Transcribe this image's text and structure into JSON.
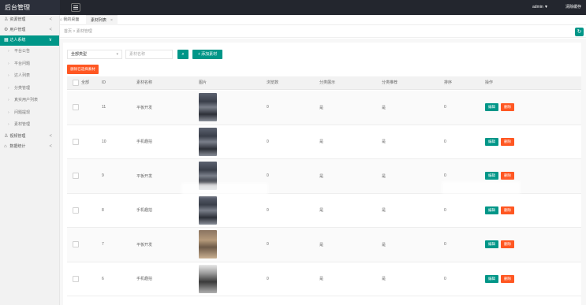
{
  "header": {
    "brand": "后台管理",
    "user": "admin ▼",
    "logout": "清除缓存"
  },
  "sidebar": {
    "items": [
      {
        "icon": "user-icon",
        "glyph": "♙",
        "label": "资源管理",
        "arrow": "<"
      },
      {
        "icon": "gear-icon",
        "glyph": "⚙",
        "label": "用户管理",
        "arrow": "<"
      },
      {
        "icon": "grid-icon",
        "glyph": "▦",
        "label": "达人系统",
        "arrow": "∨",
        "active": true
      },
      {
        "icon": "user-icon",
        "glyph": "♙",
        "label": "视频管理",
        "arrow": "<"
      },
      {
        "icon": "home-icon",
        "glyph": "⌂",
        "label": "数据统计",
        "arrow": "<"
      }
    ],
    "sub_items": [
      "平台公告",
      "平台问题",
      "达人列表",
      "分类管理",
      "真实用户列表",
      "问题提现",
      "素材管理"
    ]
  },
  "tabs": {
    "home": "我的桌面",
    "active": "素材列表",
    "close": "×"
  },
  "breadcrumb": "首页 > 素材管理",
  "filters": {
    "type_select": "全部类型",
    "search_placeholder": "素材名称",
    "search_icon": "search-icon",
    "add_button": "+ 添加素材",
    "batch_delete": "删除已选择素材"
  },
  "table": {
    "columns": [
      "全部",
      "ID",
      "素材名称",
      "图片",
      "浏览数",
      "分类展示",
      "分类推荐",
      "排序",
      "操作"
    ],
    "edit_label": "编辑",
    "delete_label": "删除",
    "rows": [
      {
        "id": "11",
        "name": "平板开发",
        "views": "0",
        "show": "是",
        "recommend": "是",
        "sort": "0",
        "thumb": "a"
      },
      {
        "id": "10",
        "name": "手机趣拍",
        "views": "0",
        "show": "是",
        "recommend": "是",
        "sort": "0",
        "thumb": "a"
      },
      {
        "id": "9",
        "name": "平板开发",
        "views": "0",
        "show": "是",
        "recommend": "是",
        "sort": "0",
        "thumb": "a"
      },
      {
        "id": "8",
        "name": "手机趣拍",
        "views": "0",
        "show": "是",
        "recommend": "是",
        "sort": "0",
        "thumb": "a"
      },
      {
        "id": "7",
        "name": "平板开发",
        "views": "0",
        "show": "是",
        "recommend": "是",
        "sort": "0",
        "thumb": "b"
      },
      {
        "id": "6",
        "name": "手机趣拍",
        "views": "0",
        "show": "是",
        "recommend": "是",
        "sort": "0",
        "thumb": "c"
      }
    ]
  },
  "colors": {
    "primary": "#009688",
    "danger": "#ff5722",
    "header_bg": "#23262e"
  }
}
